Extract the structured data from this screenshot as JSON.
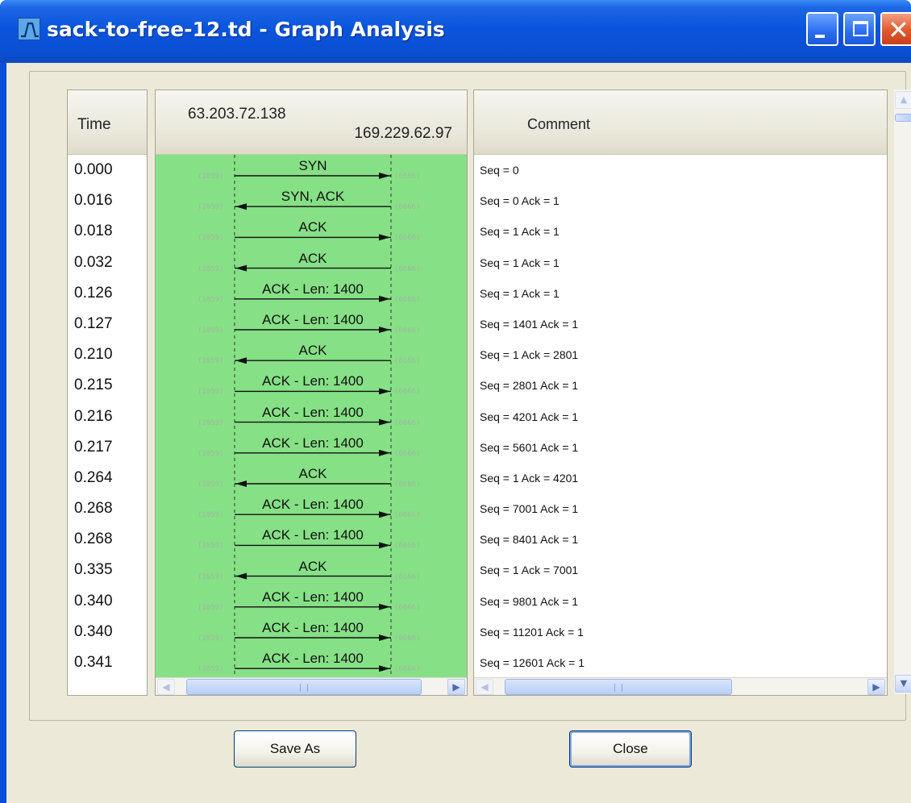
{
  "window": {
    "title": "sack-to-free-12.td - Graph Analysis",
    "controls": [
      "minimize-icon",
      "maximize-icon",
      "close-icon"
    ]
  },
  "columns": {
    "time_header": "Time",
    "comment_header": "Comment",
    "host_left": "63.203.72.138",
    "host_right": "169.229.62.97"
  },
  "rows": [
    {
      "time": "0.000",
      "label": "SYN",
      "direction": "right",
      "port_left": "(1059)",
      "port_right": "(6666)",
      "comment": "Seq = 0"
    },
    {
      "time": "0.016",
      "label": "SYN, ACK",
      "direction": "left",
      "port_left": "(1059)",
      "port_right": "(6666)",
      "comment": "Seq = 0 Ack = 1"
    },
    {
      "time": "0.018",
      "label": "ACK",
      "direction": "right",
      "port_left": "(1059)",
      "port_right": "(6666)",
      "comment": "Seq = 1 Ack = 1"
    },
    {
      "time": "0.032",
      "label": "ACK",
      "direction": "left",
      "port_left": "(1059)",
      "port_right": "(6666)",
      "comment": "Seq = 1 Ack = 1"
    },
    {
      "time": "0.126",
      "label": "ACK - Len: 1400",
      "direction": "right",
      "port_left": "(1059)",
      "port_right": "(6666)",
      "comment": "Seq = 1 Ack = 1"
    },
    {
      "time": "0.127",
      "label": "ACK - Len: 1400",
      "direction": "right",
      "port_left": "(1059)",
      "port_right": "(6666)",
      "comment": "Seq = 1401 Ack = 1"
    },
    {
      "time": "0.210",
      "label": "ACK",
      "direction": "left",
      "port_left": "(1059)",
      "port_right": "(6666)",
      "comment": "Seq = 1 Ack = 2801"
    },
    {
      "time": "0.215",
      "label": "ACK - Len: 1400",
      "direction": "right",
      "port_left": "(1059)",
      "port_right": "(6666)",
      "comment": "Seq = 2801 Ack = 1"
    },
    {
      "time": "0.216",
      "label": "ACK - Len: 1400",
      "direction": "right",
      "port_left": "(1059)",
      "port_right": "(6666)",
      "comment": "Seq = 4201 Ack = 1"
    },
    {
      "time": "0.217",
      "label": "ACK - Len: 1400",
      "direction": "right",
      "port_left": "(1059)",
      "port_right": "(6666)",
      "comment": "Seq = 5601 Ack = 1"
    },
    {
      "time": "0.264",
      "label": "ACK",
      "direction": "left",
      "port_left": "(1059)",
      "port_right": "(6666)",
      "comment": "Seq = 1 Ack = 4201"
    },
    {
      "time": "0.268",
      "label": "ACK - Len: 1400",
      "direction": "right",
      "port_left": "(1059)",
      "port_right": "(6666)",
      "comment": "Seq = 7001 Ack = 1"
    },
    {
      "time": "0.268",
      "label": "ACK - Len: 1400",
      "direction": "right",
      "port_left": "(1059)",
      "port_right": "(6666)",
      "comment": "Seq = 8401 Ack = 1"
    },
    {
      "time": "0.335",
      "label": "ACK",
      "direction": "left",
      "port_left": "(1059)",
      "port_right": "(6666)",
      "comment": "Seq = 1 Ack = 7001"
    },
    {
      "time": "0.340",
      "label": "ACK - Len: 1400",
      "direction": "right",
      "port_left": "(1059)",
      "port_right": "(6666)",
      "comment": "Seq = 9801 Ack = 1"
    },
    {
      "time": "0.340",
      "label": "ACK - Len: 1400",
      "direction": "right",
      "port_left": "(1059)",
      "port_right": "(6666)",
      "comment": "Seq = 11201 Ack = 1"
    },
    {
      "time": "0.341",
      "label": "ACK - Len: 1400",
      "direction": "right",
      "port_left": "(1059)",
      "port_right": "(6666)",
      "comment": "Seq = 12601 Ack = 1"
    }
  ],
  "buttons": {
    "save_as": "Save As",
    "close": "Close"
  },
  "colors": {
    "graph_background": "#86e086",
    "titlebar": "#0a55dc",
    "dialog_background": "#ece9d8"
  }
}
